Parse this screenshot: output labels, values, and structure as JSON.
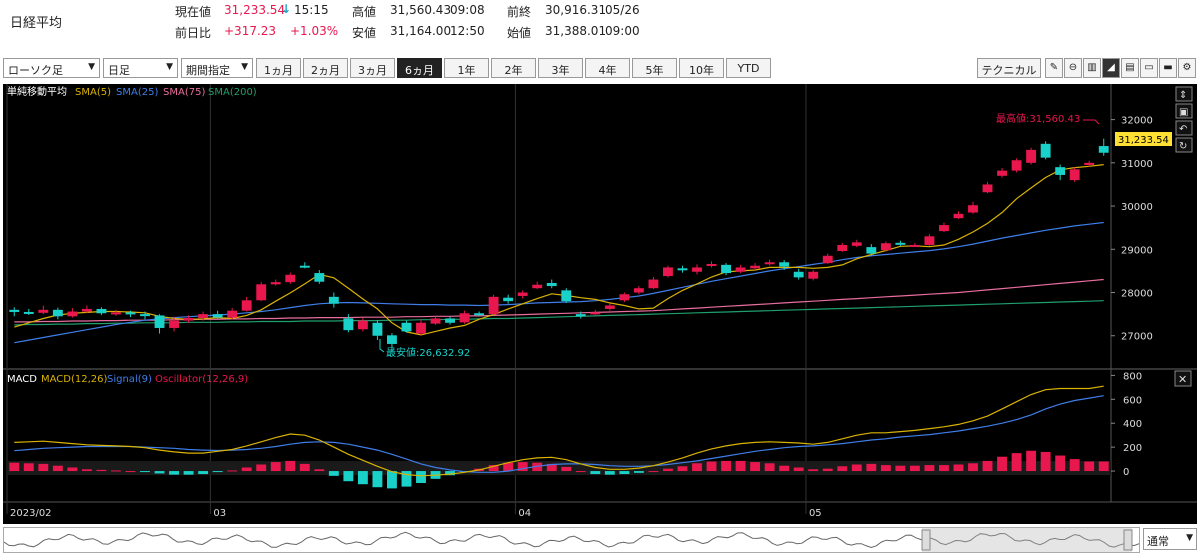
{
  "header": {
    "index_name": "日経平均",
    "current_label": "現在値",
    "current_value": "31,233.54",
    "current_arrow": "↓",
    "current_time": "15:15",
    "change_label": "前日比",
    "change_value": "+317.23",
    "change_pct": "+1.03%",
    "high_label": "高値",
    "high_value": "31,560.43",
    "high_time": "09:08",
    "low_label": "安値",
    "low_value": "31,164.00",
    "low_time": "12:50",
    "prev_label": "前終",
    "prev_value": "30,916.31",
    "prev_date": "05/26",
    "open_label": "始値",
    "open_value": "31,388.01",
    "open_time": "09:00",
    "up_color": "#e8174e",
    "down_color": "#1ad1c9"
  },
  "toolbar": {
    "chart_type": "ローソク足",
    "interval": "日足",
    "period_select": "期間指定",
    "periods": [
      "1ヵ月",
      "2ヵ月",
      "3ヵ月",
      "6ヵ月",
      "1年",
      "2年",
      "3年",
      "4年",
      "5年",
      "10年",
      "YTD"
    ],
    "active_period": "6ヵ月",
    "technical_button": "テクニカル",
    "icons": [
      "pencil-icon",
      "zoom-icon",
      "volume-icon",
      "area-chart-icon",
      "print-icon",
      "folder-open-icon",
      "folder-icon",
      "globe-icon",
      "settings-icon"
    ]
  },
  "navigator": {
    "mode": "通常"
  },
  "chart_data": [
    {
      "type": "candlestick",
      "legend": {
        "label": "単純移動平均",
        "sma5": "SMA(5)",
        "sma25": "SMA(25)",
        "sma75": "SMA(75)",
        "sma200": "SMA(200)"
      },
      "series_colors": {
        "sma5": "#d9b300",
        "sma25": "#3f7ee8",
        "sma75": "#e86e9e",
        "sma200": "#1f9e6e",
        "up": "#e8174e",
        "down": "#1ad1c9"
      },
      "ylim": [
        26300,
        32500
      ],
      "yticks": [
        27000,
        28000,
        29000,
        30000,
        31000,
        32000
      ],
      "x_labels": [
        {
          "label": "2023/02",
          "index": 0
        },
        {
          "label": "03",
          "index": 14
        },
        {
          "label": "04",
          "index": 35
        },
        {
          "label": "05",
          "index": 55
        }
      ],
      "last_price_label": "31,233.54",
      "max_label": "最高値:31,560.43",
      "min_label": "最安値:26,632.92",
      "candles": [
        [
          27600,
          27550,
          27660,
          27450
        ],
        [
          27550,
          27530,
          27620,
          27480
        ],
        [
          27530,
          27600,
          27700,
          27500
        ],
        [
          27600,
          27450,
          27650,
          27380
        ],
        [
          27450,
          27560,
          27640,
          27420
        ],
        [
          27560,
          27620,
          27700,
          27520
        ],
        [
          27620,
          27520,
          27660,
          27480
        ],
        [
          27520,
          27540,
          27600,
          27460
        ],
        [
          27540,
          27500,
          27580,
          27430
        ],
        [
          27500,
          27470,
          27560,
          27380
        ],
        [
          27470,
          27180,
          27500,
          27050
        ],
        [
          27180,
          27350,
          27440,
          27100
        ],
        [
          27350,
          27410,
          27470,
          27300
        ],
        [
          27410,
          27500,
          27560,
          27350
        ],
        [
          27500,
          27420,
          27580,
          27380
        ],
        [
          27420,
          27580,
          27640,
          27380
        ],
        [
          27580,
          27820,
          27900,
          27560
        ],
        [
          27820,
          28190,
          28240,
          27800
        ],
        [
          28190,
          28240,
          28300,
          28160
        ],
        [
          28240,
          28410,
          28460,
          28200
        ],
        [
          28620,
          28600,
          28700,
          28560
        ],
        [
          28450,
          28250,
          28520,
          28200
        ],
        [
          27900,
          27740,
          28000,
          27650
        ],
        [
          27400,
          27130,
          27500,
          27080
        ],
        [
          27150,
          27350,
          27420,
          27100
        ],
        [
          27300,
          27000,
          27360,
          26900
        ],
        [
          27010,
          26810,
          27060,
          26632.92
        ],
        [
          27300,
          27100,
          27350,
          27080
        ],
        [
          27050,
          27300,
          27380,
          27000
        ],
        [
          27280,
          27400,
          27450,
          27250
        ],
        [
          27400,
          27300,
          27440,
          27260
        ],
        [
          27310,
          27520,
          27580,
          27280
        ],
        [
          27520,
          27500,
          27560,
          27460
        ],
        [
          27500,
          27900,
          27950,
          27480
        ],
        [
          27880,
          27800,
          27950,
          27740
        ],
        [
          27920,
          28000,
          28050,
          27860
        ],
        [
          28100,
          28180,
          28250,
          28080
        ],
        [
          28220,
          28150,
          28300,
          28100
        ],
        [
          28050,
          27800,
          28100,
          27760
        ],
        [
          27500,
          27450,
          27560,
          27400
        ],
        [
          27500,
          27540,
          27600,
          27480
        ],
        [
          27620,
          27700,
          27750,
          27580
        ],
        [
          27820,
          27960,
          28000,
          27780
        ],
        [
          28000,
          28100,
          28150,
          27960
        ],
        [
          28100,
          28300,
          28360,
          28080
        ],
        [
          28380,
          28580,
          28620,
          28350
        ],
        [
          28560,
          28520,
          28620,
          28460
        ],
        [
          28480,
          28580,
          28650,
          28420
        ],
        [
          28620,
          28660,
          28720,
          28580
        ],
        [
          28640,
          28450,
          28680,
          28400
        ],
        [
          28480,
          28580,
          28640,
          28450
        ],
        [
          28560,
          28620,
          28680,
          28520
        ],
        [
          28660,
          28700,
          28760,
          28620
        ],
        [
          28700,
          28600,
          28750,
          28520
        ],
        [
          28480,
          28350,
          28550,
          28300
        ],
        [
          28320,
          28480,
          28520,
          28280
        ],
        [
          28680,
          28850,
          28900,
          28660
        ],
        [
          28960,
          29100,
          29150,
          28940
        ],
        [
          29080,
          29160,
          29220,
          29050
        ],
        [
          29050,
          28900,
          29120,
          28850
        ],
        [
          28980,
          29140,
          29180,
          28950
        ],
        [
          29150,
          29120,
          29200,
          29080
        ],
        [
          29100,
          29100,
          29140,
          29060
        ],
        [
          29100,
          29300,
          29350,
          29080
        ],
        [
          29420,
          29560,
          29620,
          29400
        ],
        [
          29720,
          29820,
          29880,
          29700
        ],
        [
          29850,
          30020,
          30100,
          29820
        ],
        [
          30320,
          30500,
          30560,
          30300
        ],
        [
          30700,
          30820,
          30880,
          30660
        ],
        [
          30820,
          31060,
          31100,
          30780
        ],
        [
          31000,
          31300,
          31350,
          30960
        ],
        [
          31440,
          31120,
          31500,
          31080
        ],
        [
          30900,
          30720,
          30960,
          30600
        ],
        [
          30600,
          30850,
          30900,
          30560
        ],
        [
          30950,
          31000,
          31050,
          30900
        ],
        [
          31388.01,
          31233.54,
          31560.43,
          31164.0
        ]
      ],
      "sma5": [
        27200,
        27300,
        27400,
        27480,
        27520,
        27540,
        27560,
        27560,
        27550,
        27530,
        27450,
        27400,
        27380,
        27390,
        27420,
        27400,
        27470,
        27600,
        27800,
        27990,
        28200,
        28420,
        28340,
        28100,
        27850,
        27620,
        27300,
        27090,
        27020,
        27100,
        27180,
        27240,
        27380,
        27490,
        27620,
        27740,
        27860,
        27970,
        27930,
        27880,
        27840,
        27760,
        27700,
        27620,
        27640,
        27860,
        28050,
        28200,
        28360,
        28480,
        28500,
        28520,
        28580,
        28580,
        28580,
        28560,
        28580,
        28640,
        28780,
        28880,
        28970,
        29070,
        29080,
        29060,
        29100,
        29230,
        29400,
        29600,
        29850,
        30170,
        30420,
        30660,
        30840,
        30890,
        30920,
        30960
      ],
      "sma25": [
        26840,
        26900,
        26960,
        27020,
        27080,
        27140,
        27200,
        27260,
        27310,
        27360,
        27390,
        27420,
        27440,
        27460,
        27480,
        27500,
        27530,
        27560,
        27600,
        27650,
        27700,
        27740,
        27760,
        27770,
        27760,
        27750,
        27740,
        27730,
        27720,
        27720,
        27710,
        27710,
        27700,
        27710,
        27720,
        27740,
        27760,
        27770,
        27780,
        27790,
        27810,
        27840,
        27880,
        27920,
        27980,
        28050,
        28120,
        28190,
        28260,
        28320,
        28380,
        28440,
        28500,
        28550,
        28600,
        28650,
        28700,
        28760,
        28810,
        28850,
        28880,
        28910,
        28940,
        28970,
        29010,
        29060,
        29120,
        29190,
        29260,
        29320,
        29380,
        29440,
        29490,
        29540,
        29580,
        29620
      ],
      "sma75": [
        27320,
        27320,
        27330,
        27330,
        27340,
        27340,
        27350,
        27350,
        27360,
        27360,
        27360,
        27370,
        27370,
        27380,
        27380,
        27390,
        27390,
        27400,
        27400,
        27410,
        27410,
        27420,
        27420,
        27420,
        27430,
        27430,
        27430,
        27440,
        27440,
        27450,
        27450,
        27460,
        27460,
        27470,
        27480,
        27490,
        27500,
        27510,
        27520,
        27530,
        27540,
        27550,
        27560,
        27570,
        27580,
        27600,
        27620,
        27640,
        27660,
        27680,
        27700,
        27720,
        27740,
        27760,
        27780,
        27800,
        27820,
        27840,
        27860,
        27880,
        27900,
        27920,
        27940,
        27960,
        27980,
        28000,
        28030,
        28060,
        28090,
        28120,
        28150,
        28180,
        28210,
        28240,
        28270,
        28300
      ],
      "sma200": [
        27250,
        27260,
        27260,
        27270,
        27270,
        27280,
        27280,
        27290,
        27290,
        27300,
        27300,
        27300,
        27310,
        27310,
        27310,
        27320,
        27320,
        27330,
        27330,
        27330,
        27340,
        27340,
        27340,
        27350,
        27350,
        27350,
        27360,
        27360,
        27370,
        27370,
        27380,
        27380,
        27390,
        27400,
        27400,
        27410,
        27420,
        27430,
        27440,
        27450,
        27460,
        27470,
        27480,
        27490,
        27500,
        27510,
        27520,
        27530,
        27540,
        27550,
        27560,
        27570,
        27580,
        27590,
        27600,
        27610,
        27620,
        27630,
        27640,
        27650,
        27660,
        27670,
        27680,
        27690,
        27700,
        27710,
        27720,
        27730,
        27740,
        27750,
        27760,
        27770,
        27780,
        27790,
        27800,
        27810
      ]
    },
    {
      "type": "macd",
      "legend": {
        "label": "MACD",
        "macd": "MACD(12,26)",
        "signal": "Signal(9)",
        "osc": "Oscillator(12,26,9)"
      },
      "series_colors": {
        "macd": "#d9b300",
        "signal": "#3f7ee8",
        "osc_pos": "#e8174e",
        "osc_neg": "#1ad1c9"
      },
      "ylim": [
        -150,
        820
      ],
      "yticks": [
        0,
        200,
        400,
        600,
        800
      ],
      "macd": [
        240,
        245,
        250,
        240,
        230,
        220,
        215,
        210,
        205,
        195,
        175,
        160,
        150,
        150,
        165,
        180,
        210,
        245,
        280,
        310,
        300,
        260,
        200,
        140,
        90,
        40,
        -5,
        -30,
        -40,
        -35,
        -25,
        -10,
        10,
        40,
        70,
        95,
        110,
        115,
        95,
        60,
        30,
        15,
        15,
        25,
        45,
        75,
        110,
        150,
        185,
        210,
        230,
        240,
        245,
        240,
        235,
        225,
        240,
        270,
        300,
        320,
        320,
        330,
        340,
        355,
        370,
        390,
        420,
        460,
        520,
        580,
        640,
        680,
        690,
        690,
        690,
        710
      ],
      "signal": [
        170,
        180,
        190,
        195,
        200,
        205,
        205,
        205,
        205,
        200,
        195,
        190,
        180,
        175,
        172,
        175,
        180,
        190,
        205,
        225,
        240,
        245,
        240,
        225,
        200,
        175,
        140,
        100,
        60,
        30,
        10,
        -5,
        -10,
        -10,
        0,
        20,
        40,
        55,
        60,
        60,
        55,
        45,
        40,
        40,
        45,
        55,
        70,
        85,
        105,
        125,
        145,
        165,
        180,
        195,
        205,
        210,
        220,
        230,
        245,
        260,
        270,
        285,
        295,
        305,
        320,
        335,
        355,
        375,
        400,
        430,
        470,
        520,
        560,
        590,
        610,
        630
      ],
      "osc": [
        70,
        65,
        60,
        45,
        30,
        15,
        10,
        5,
        0,
        -5,
        -20,
        -30,
        -30,
        -25,
        -7,
        5,
        30,
        55,
        75,
        85,
        60,
        15,
        -40,
        -85,
        -110,
        -135,
        -145,
        -130,
        -100,
        -65,
        -35,
        -5,
        20,
        50,
        70,
        75,
        70,
        60,
        35,
        0,
        -25,
        -30,
        -25,
        -15,
        0,
        20,
        40,
        65,
        80,
        85,
        85,
        75,
        65,
        45,
        30,
        15,
        20,
        40,
        55,
        60,
        50,
        45,
        45,
        50,
        50,
        55,
        65,
        85,
        120,
        150,
        170,
        160,
        130,
        100,
        80,
        80
      ]
    }
  ]
}
